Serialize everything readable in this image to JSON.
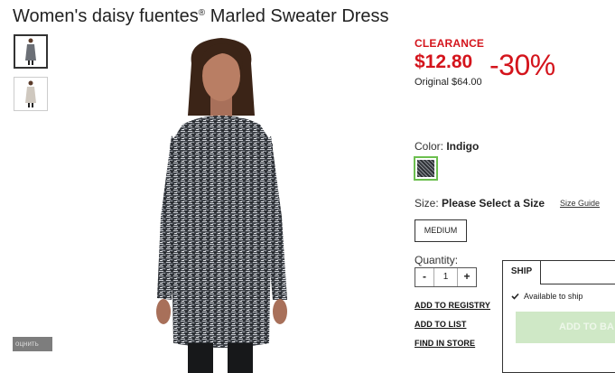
{
  "product": {
    "title_main": "Women's daisy fuentes",
    "title_mark": "®",
    "title_rest": " Marled Sweater Dress"
  },
  "thumbnails": [
    {
      "label": "thumbnail-1",
      "active": true
    },
    {
      "label": "thumbnail-2",
      "active": false
    }
  ],
  "corner_tag": "оцнить",
  "pricing": {
    "clearance_label": "CLEARANCE",
    "sale_price": "$12.80",
    "discount": "-30%",
    "original_price": "Original $64.00",
    "color": "#d4141c"
  },
  "color": {
    "label": "Color: ",
    "value": "Indigo",
    "swatch_border": "#6cbf4f"
  },
  "size": {
    "label": "Size: ",
    "value": "Please Select a Size",
    "guide_link": "Size Guide",
    "options": [
      "MEDIUM"
    ]
  },
  "quantity": {
    "label": "Quantity:",
    "minus": "-",
    "value": "1",
    "plus": "+"
  },
  "links": {
    "registry": "ADD TO REGISTRY",
    "list": "ADD TO LIST",
    "store": "FIND IN STORE"
  },
  "ship": {
    "tab_label": "SHIP",
    "availability": "Available to ship",
    "add_button": "ADD TO BA",
    "add_button_color": "#cfe8c6"
  }
}
